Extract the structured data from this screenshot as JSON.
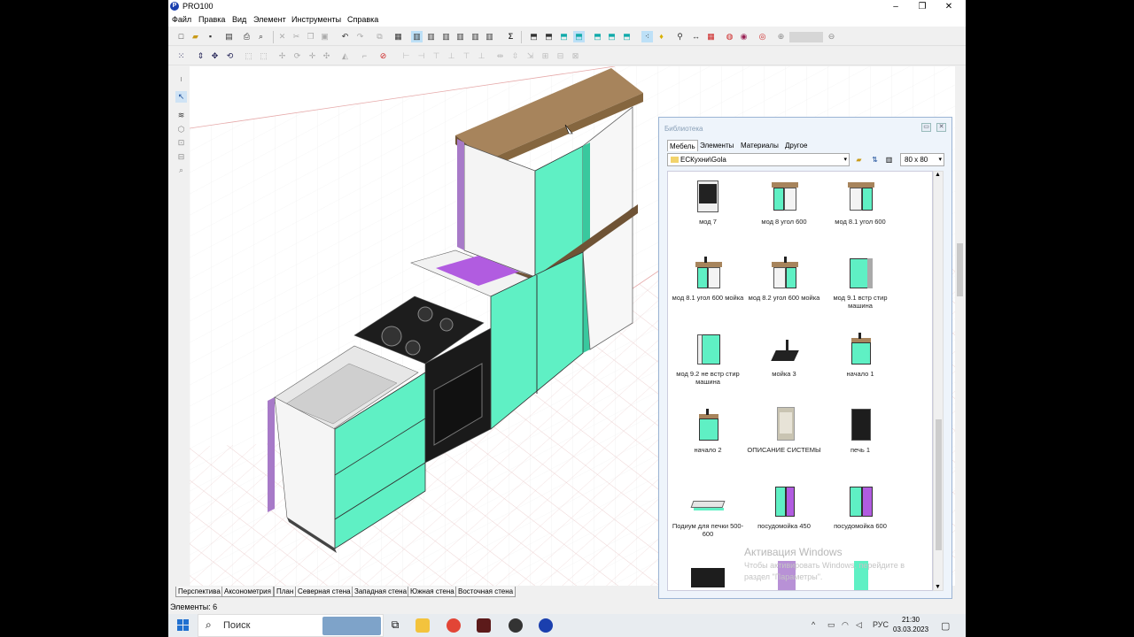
{
  "window": {
    "title": "PRO100",
    "minimize": "–",
    "restore": "❐",
    "close": "✕"
  },
  "menu": [
    "Файл",
    "Правка",
    "Вид",
    "Элемент",
    "Инструменты",
    "Справка"
  ],
  "view_tabs": [
    "Перспектива",
    "Аксонометрия",
    "План",
    "Северная стена",
    "Западная стена",
    "Южная стена",
    "Восточная стена"
  ],
  "status": {
    "elements": "Элементы: 6"
  },
  "library": {
    "title": "Библиотека",
    "tabs": [
      "Мебель",
      "Элементы",
      "Материалы",
      "Другое"
    ],
    "active_tab": "Мебель",
    "path": "ЕСКухни\\Gola",
    "size": "80 x  80",
    "items": [
      {
        "label": "мод 7",
        "icon": "oven-cabinet"
      },
      {
        "label": "мод 8 угол 600",
        "icon": "corner-cabinet"
      },
      {
        "label": "мод 8.1 угол 600",
        "icon": "corner-cabinet"
      },
      {
        "label": "мод 8.1 угол 600 мойка",
        "icon": "sink-corner-cabinet"
      },
      {
        "label": "мод 8.2 угол 600 мойка",
        "icon": "sink-corner-cabinet"
      },
      {
        "label": "мод 9.1 встр стир машина",
        "icon": "washer-cabinet"
      },
      {
        "label": "мод 9.2 не встр стир машина",
        "icon": "washer-cabinet"
      },
      {
        "label": "мойка 3",
        "icon": "sink"
      },
      {
        "label": "начало 1",
        "icon": "start-cabinet"
      },
      {
        "label": "начало 2",
        "icon": "start-cabinet"
      },
      {
        "label": "ОПИСАНИЕ СИСТЕМЫ",
        "icon": "document"
      },
      {
        "label": "печь 1",
        "icon": "oven"
      },
      {
        "label": "Подиум для печки 500-600",
        "icon": "podium"
      },
      {
        "label": "посудомойка 450",
        "icon": "dishwasher"
      },
      {
        "label": "посудомойка 600",
        "icon": "dishwasher"
      }
    ]
  },
  "activation": {
    "title": "Активация Windows",
    "text": "Чтобы активировать Windows, перейдите в раздел \"Параметры\"."
  },
  "taskbar": {
    "search": "Поиск",
    "lang": "РУС",
    "time": "21:30",
    "date": "03.03.2023"
  },
  "colors": {
    "mint": "#5ff0c4",
    "purple": "#b27ad8",
    "wood": "#a7845c",
    "grid_line": "#e7b2b2"
  }
}
